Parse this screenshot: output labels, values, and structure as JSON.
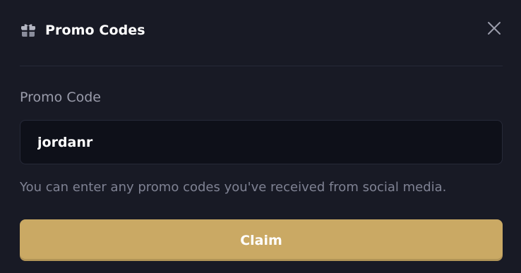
{
  "modal": {
    "title": "Promo Codes",
    "title_icon": "gift-icon",
    "close_icon": "close-icon"
  },
  "form": {
    "label": "Promo Code",
    "input_value": "jordanr",
    "hint": "You can enter any promo codes you've received from social media.",
    "claim_label": "Claim"
  },
  "colors": {
    "background": "#181a25",
    "input_background": "#0e1019",
    "accent": "#caa964",
    "title_text": "#ffffff",
    "label_text": "#9a9cab",
    "hint_text": "#7f8293"
  }
}
